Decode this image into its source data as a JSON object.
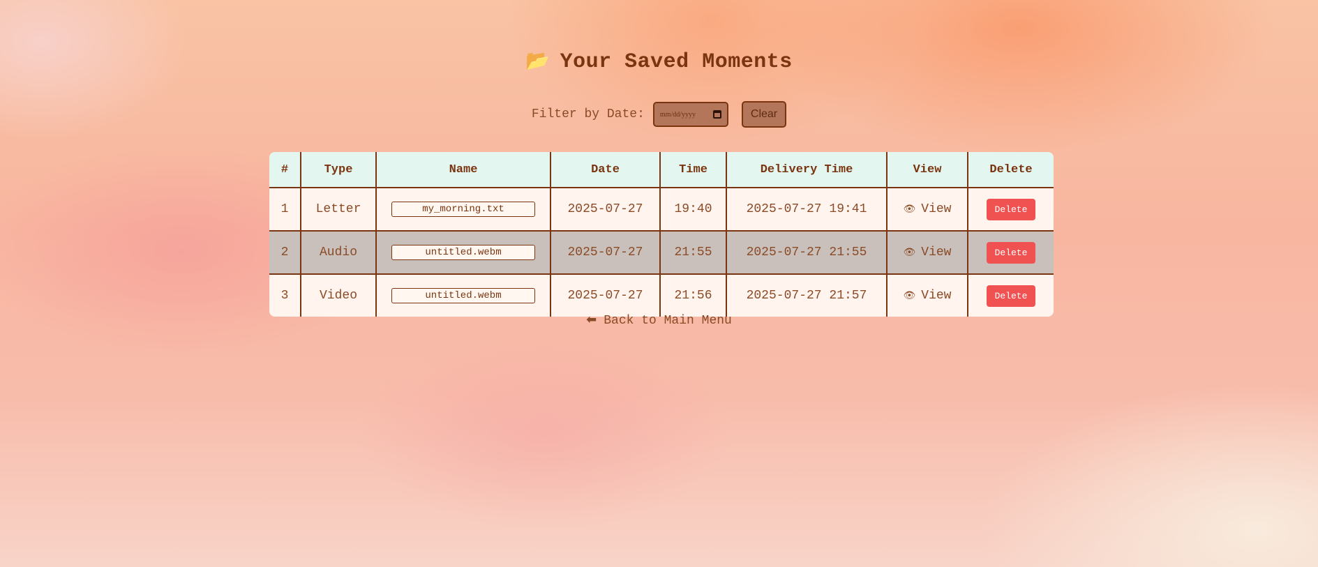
{
  "page": {
    "title": "Your Saved Moments",
    "title_icon": "📂"
  },
  "filter": {
    "label": "Filter by Date:",
    "date_placeholder": "mm/dd/yyyy",
    "clear_label": "Clear"
  },
  "table": {
    "headers": [
      "#",
      "Type",
      "Name",
      "Date",
      "Time",
      "Delivery Time",
      "View",
      "Delete"
    ],
    "rows": [
      {
        "num": "1",
        "type": "Letter",
        "name": "my_morning.txt",
        "date": "2025-07-27",
        "time": "19:40",
        "delivery": "2025-07-27 19:41",
        "view": "View",
        "delete": "Delete"
      },
      {
        "num": "2",
        "type": "Audio",
        "name": "untitled.webm",
        "date": "2025-07-27",
        "time": "21:55",
        "delivery": "2025-07-27 21:55",
        "view": "View",
        "delete": "Delete"
      },
      {
        "num": "3",
        "type": "Video",
        "name": "untitled.webm",
        "date": "2025-07-27",
        "time": "21:56",
        "delivery": "2025-07-27 21:57",
        "view": "View",
        "delete": "Delete"
      }
    ],
    "highlighted_row": 2
  },
  "nav": {
    "back_label": "Back to Main Menu",
    "back_icon": "⬅"
  },
  "colors": {
    "accent_brown": "#7a3510",
    "header_bg": "#e3f6f0",
    "row_bg": "#fff4ee",
    "highlight_row_bg": "#c9c0bb",
    "delete_red": "#f05252"
  }
}
